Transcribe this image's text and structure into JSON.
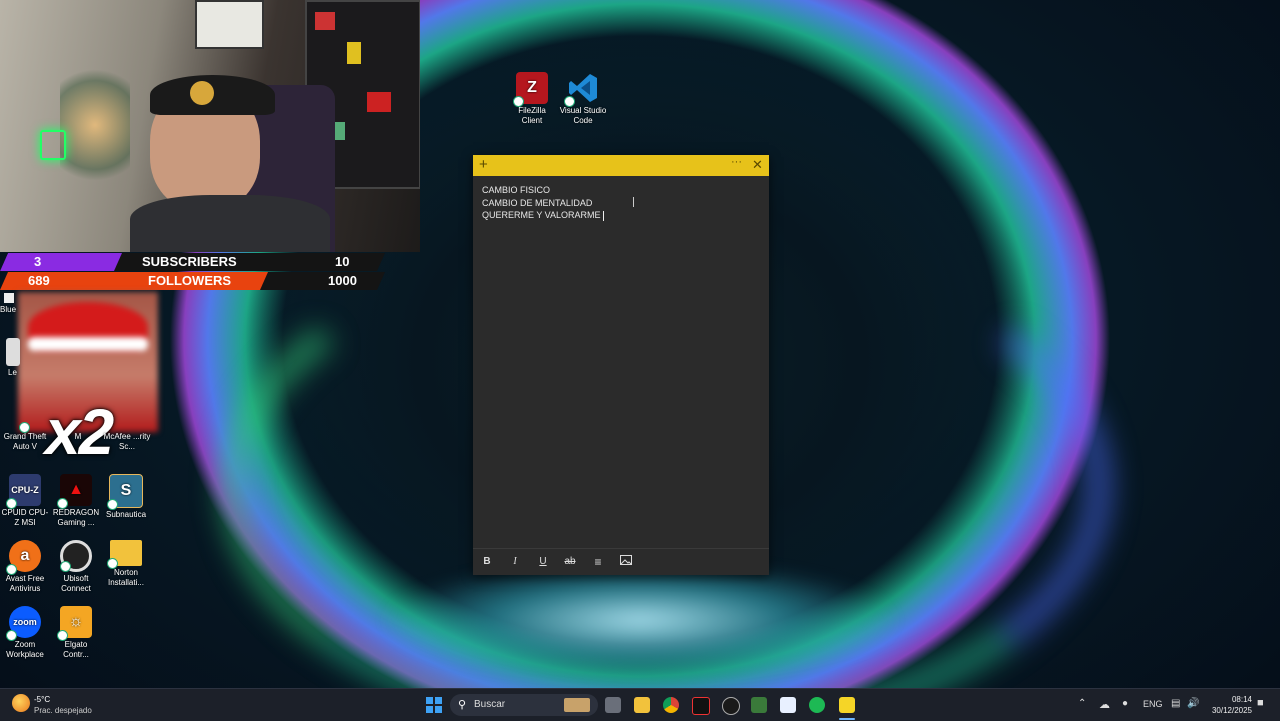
{
  "stream_overlay": {
    "subscribers": {
      "current": "3",
      "label": "SUBSCRIBERS",
      "goal": "10"
    },
    "followers": {
      "current": "689",
      "label": "FOLLOWERS",
      "goal": "1000"
    },
    "multiplier": "x2"
  },
  "desktop_icons": {
    "filezilla": "FileZilla Client",
    "vscode": "Visual Studio Code",
    "blue_partial": "Blue",
    "le_partial": "Le",
    "gta": "Grand Theft Auto V",
    "m_partial": "M",
    "mcafee": "McAfee ...rity Sc...",
    "cpuz": "CPUID CPU-Z MSI",
    "redragon": "REDRAGON Gaming ...",
    "subnautica": "Subnautica",
    "avast": "Avast Free Antivirus",
    "ubisoft": "Ubisoft Connect",
    "norton": "Norton Installati...",
    "zoom": "Zoom Workplace",
    "elgato": "Elgato Contr..."
  },
  "sticky_note": {
    "lines": [
      "CAMBIO FISICO",
      "CAMBIO DE MENTALIDAD",
      "QUERERME Y VALORARME"
    ],
    "add_icon": "plus-icon",
    "menu_icon": "ellipsis-icon",
    "close_icon": "close-icon",
    "toolbar": {
      "bold": "B",
      "italic": "I",
      "underline": "U",
      "strike": "ab"
    }
  },
  "taskbar": {
    "weather_temp": "-5°C",
    "weather_desc": "Prac. despejado",
    "search_placeholder": "Buscar",
    "language": "ENG",
    "time": "08:14",
    "date": "30/12/2025"
  },
  "colors": {
    "note_header": "#e7c21a",
    "note_body": "#2b2b2b",
    "sub_bar": "#8a2be2",
    "follow_bar": "#e8430f"
  }
}
